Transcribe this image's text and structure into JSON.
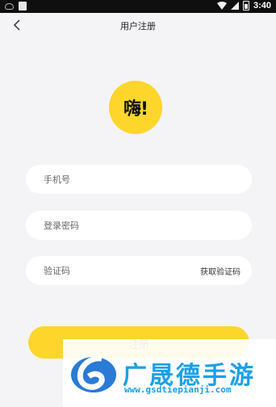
{
  "status_bar": {
    "time": "3:40"
  },
  "header": {
    "title": "用户注册"
  },
  "logo": {
    "text": "嗨!"
  },
  "form": {
    "phone_placeholder": "手机号",
    "password_placeholder": "登录密码",
    "code_placeholder": "验证码",
    "get_code_label": "获取验证码"
  },
  "register_button": {
    "label": "注册"
  },
  "watermark": {
    "title": "广晟德手游",
    "url": "www.gsdtiepianji.com"
  },
  "colors": {
    "accent": "#fed52a",
    "background": "#f4f4f6",
    "watermark_blue": "#1aa0e6"
  }
}
